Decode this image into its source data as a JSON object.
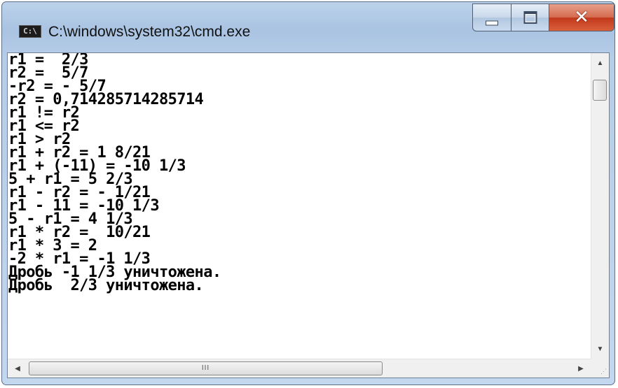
{
  "window": {
    "title": "C:\\windows\\system32\\cmd.exe",
    "icon_text": "C:\\",
    "controls": {
      "minimize": "minimize-icon",
      "maximize": "maximize-icon",
      "close": "✕"
    }
  },
  "console": {
    "lines": [
      "r1 =  2/3",
      "r2 =  5/7",
      "-r2 = - 5/7",
      "r2 = 0,714285714285714",
      "r1 != r2",
      "r1 <= r2",
      "r1 > r2",
      "r1 + r2 = 1 8/21",
      "r1 + (-11) = -10 1/3",
      "5 + r1 = 5 2/3",
      "r1 - r2 = - 1/21",
      "r1 - 11 = -10 1/3",
      "5 - r1 = 4 1/3",
      "r1 * r2 =  10/21",
      "r1 * 3 = 2",
      "-2 * r1 = -1 1/3",
      "Дробь -1 1/3 уничтожена.",
      "Дробь  2/3 уничтожена."
    ]
  },
  "scrollbars": {
    "up_arrow": "▲",
    "down_arrow": "▼",
    "left_arrow": "◀",
    "right_arrow": "▶",
    "grip": "III",
    "resize_grip": "⋰"
  }
}
